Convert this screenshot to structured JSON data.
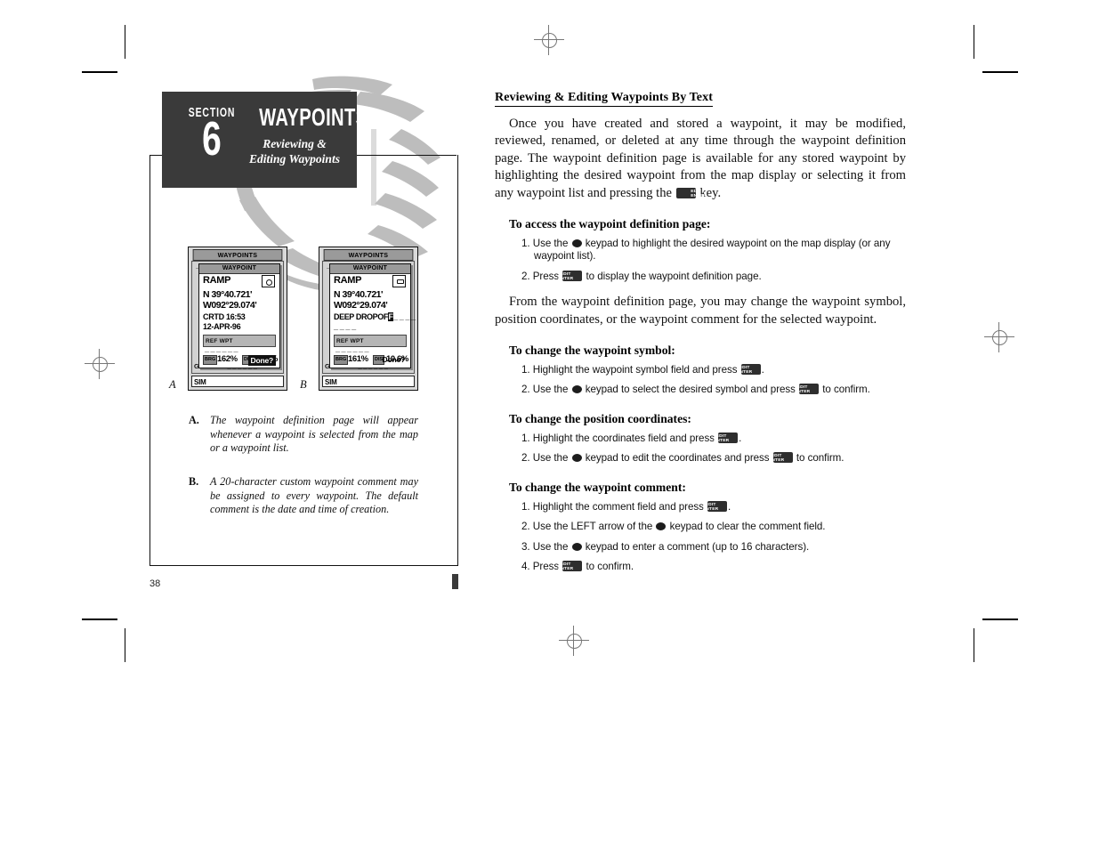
{
  "section": {
    "word": "SECTION",
    "number": "6",
    "title": "WAYPOINTS",
    "subtitle_line1": "Reviewing &",
    "subtitle_line2": "Editing Waypoints"
  },
  "page_number": "38",
  "figures": {
    "a": {
      "label": "A",
      "device_title": "WAYPOINTS",
      "list_dashes": "_ _ _ _ _             _ _ _",
      "bottom_line": "GRNTNN  °      _ _ _ _ _ _",
      "status": "SIM",
      "dialog": {
        "header": "WAYPOINT",
        "name": "RAMP",
        "symbol": "circle-symbol",
        "lat": "N  39°40.721'",
        "lon": "W092°29.074'",
        "created_label": "CRTD  16:53",
        "created_date": "12-APR-96",
        "ref_label": "REF WPT",
        "ref_value": "_ _ _ _ _ _",
        "brg_label": "BRG",
        "brg_value": "162%",
        "dis_label": "DIS",
        "dis_value": "9.99%",
        "done_label": "Done?",
        "done_highlighted": true
      }
    },
    "b": {
      "label": "B",
      "device_title": "WAYPOINTS",
      "list_dashes": "_ _ _ _ _             _ _ _",
      "bottom_line": "GRNTNN  °      _ _ _ _ _ _",
      "status": "SIM",
      "dialog": {
        "header": "WAYPOINT",
        "name": "RAMP",
        "symbol": "box-symbol",
        "lat": "N  39°40.721'",
        "lon": "W092°29.074'",
        "comment_text": "DEEP DROPOF",
        "comment_cursor": "F",
        "comment_trail": "_ _ _ _",
        "comment_line2": "_ _ _ _",
        "ref_label": "REF WPT",
        "ref_value": "_ _ _ _ _ _",
        "brg_label": "BRG",
        "brg_value": "161%",
        "dis_label": "DIS",
        "dis_value": "10.6%",
        "done_label": "Done?",
        "done_highlighted": false
      }
    }
  },
  "captions": [
    {
      "letter": "A.",
      "text": "The waypoint definition page will appear whenever a waypoint is selected from the map or a waypoint list."
    },
    {
      "letter": "B.",
      "text": "A 20-character custom waypoint comment may be assigned to every waypoint. The default comment is the date and time of creation."
    }
  ],
  "content": {
    "heading": "Reviewing & Editing Waypoints By Text",
    "intro_p1_a": "Once you have created and stored a waypoint, it may be modified, reviewed, renamed, or deleted at any time through the waypoint definition page. The waypoint definition page is available for any stored waypoint by highlighting the desired waypoint from the map display or selecting it from any waypoint list and pressing the ",
    "intro_p1_b": " key.",
    "intro_p2": "From the waypoint definition page, you may change the waypoint symbol, position coordinates, or the waypoint comment for the selected waypoint.",
    "keycap": {
      "line1": "EDIT",
      "line2": "ENTER"
    },
    "sections": [
      {
        "heading": "To access the waypoint definition page:",
        "steps": [
          {
            "num": "1.",
            "parts": [
              "Use the ",
              "ROCKER",
              " keypad to highlight the desired waypoint on the map display (or any waypoint list)."
            ]
          },
          {
            "num": "2.",
            "parts": [
              "Press ",
              "KEY",
              " to display the waypoint definition page."
            ]
          }
        ]
      },
      {
        "heading": "To change the waypoint symbol:",
        "steps": [
          {
            "num": "1.",
            "parts": [
              "Highlight the waypoint symbol field and press ",
              "KEY",
              "."
            ]
          },
          {
            "num": "2.",
            "parts": [
              "Use the ",
              "ROCKER",
              " keypad to select the desired symbol and press ",
              "KEY",
              " to confirm."
            ]
          }
        ]
      },
      {
        "heading": "To change the position coordinates:",
        "steps": [
          {
            "num": "1.",
            "parts": [
              "Highlight the coordinates field and press ",
              "KEY",
              "."
            ]
          },
          {
            "num": "2.",
            "parts": [
              "Use the ",
              "ROCKER",
              " keypad to edit the coordinates and press ",
              "KEY",
              " to confirm."
            ]
          }
        ]
      },
      {
        "heading": "To change the waypoint comment:",
        "steps": [
          {
            "num": "1.",
            "parts": [
              "Highlight the comment field and press ",
              "KEY",
              "."
            ]
          },
          {
            "num": "2.",
            "parts": [
              "Use the LEFT arrow of the ",
              "ROCKER",
              " keypad to clear the comment field."
            ]
          },
          {
            "num": "3.",
            "parts": [
              "Use the ",
              "ROCKER",
              " keypad to enter a comment (up to 16 characters)."
            ]
          },
          {
            "num": "4.",
            "parts": [
              "Press ",
              "KEY",
              " to confirm."
            ]
          }
        ]
      }
    ]
  },
  "colors": {
    "ink": "#111111",
    "header_block": "#3a3a3a",
    "watermark": "#bdbdbd",
    "device_body": "#d9d9d9"
  }
}
